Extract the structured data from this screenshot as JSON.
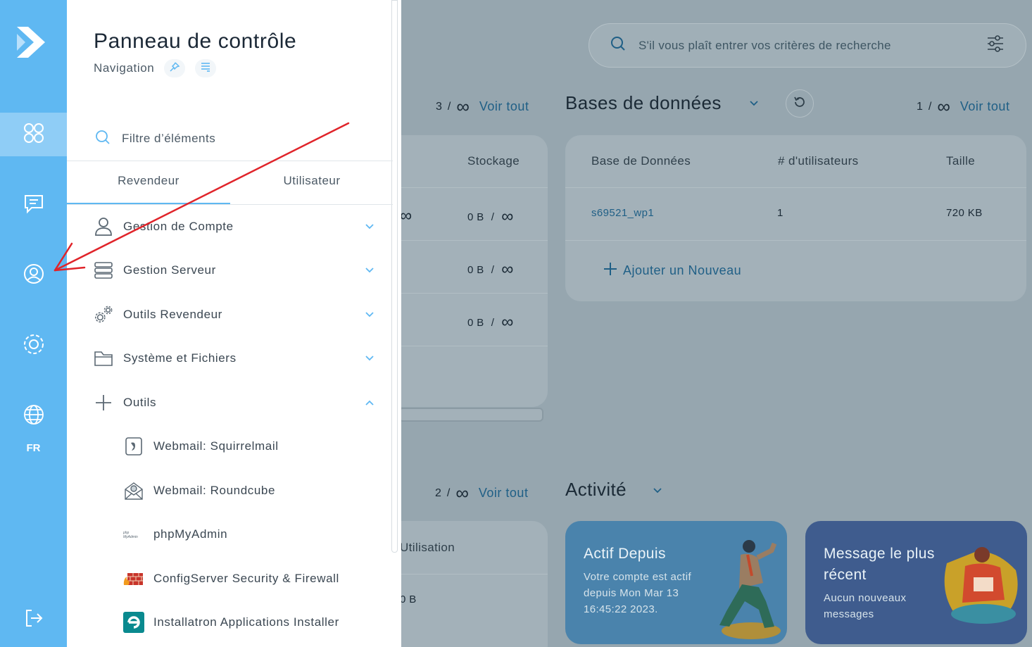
{
  "rail": {
    "items": [
      {
        "icon": "apps-grid-icon",
        "active": true
      },
      {
        "icon": "message-icon",
        "active": false
      },
      {
        "icon": "user-circle-icon",
        "active": false
      },
      {
        "icon": "settings-gear-icon",
        "active": false
      },
      {
        "icon": "globe-icon",
        "active": false
      }
    ],
    "language": "FR",
    "logout_icon": "logout-icon"
  },
  "panel": {
    "title": "Panneau de contrôle",
    "subtitle": "Navigation",
    "filter_placeholder": "Filtre d’éléments",
    "tabs": [
      {
        "label": "Revendeur",
        "active": true
      },
      {
        "label": "Utilisateur",
        "active": false
      }
    ],
    "menu": [
      {
        "label": "Gestion de Compte",
        "icon": "user-icon",
        "expanded": false
      },
      {
        "label": "Gestion Serveur",
        "icon": "server-icon",
        "expanded": false
      },
      {
        "label": "Outils Revendeur",
        "icon": "gears-icon",
        "expanded": false
      },
      {
        "label": "Système et Fichiers",
        "icon": "folder-icon",
        "expanded": false
      },
      {
        "label": "Outils",
        "icon": "plus-icon",
        "expanded": true
      }
    ],
    "submenu": [
      {
        "label": "Webmail: Squirrelmail",
        "icon": "squirrelmail-icon"
      },
      {
        "label": "Webmail: Roundcube",
        "icon": "roundcube-icon"
      },
      {
        "label": "phpMyAdmin",
        "icon": "phpmyadmin-icon"
      },
      {
        "label": "ConfigServer Security & Firewall",
        "icon": "firewall-icon"
      },
      {
        "label": "Installatron Applications Installer",
        "icon": "installatron-icon"
      }
    ]
  },
  "dashboard": {
    "search_placeholder": "S'il vous plaît entrer vos critères de recherche",
    "left_top": {
      "count": "3",
      "separator": "/",
      "infinity": "∞",
      "view_all": "Voir tout",
      "column": "Stockage",
      "rows": [
        {
          "used": "0 B",
          "sep": "/",
          "limit": "∞"
        },
        {
          "used": "0 B",
          "sep": "/",
          "limit": "∞"
        },
        {
          "used": "0 B",
          "sep": "/",
          "limit": "∞"
        }
      ],
      "partial_limit": "∞"
    },
    "databases": {
      "title": "Bases de données",
      "count": "1",
      "separator": "/",
      "infinity": "∞",
      "view_all": "Voir tout",
      "columns": [
        "Base de Données",
        "# d'utilisateurs",
        "Taille"
      ],
      "rows": [
        {
          "name": "s69521_wp1",
          "users": "1",
          "size": "720 KB"
        }
      ],
      "add_label": "Ajouter un Nouveau"
    },
    "left_bottom": {
      "count": "2",
      "separator": "/",
      "infinity": "∞",
      "view_all": "Voir tout",
      "column": "Utilisation",
      "cell": "0 B"
    },
    "activity": {
      "title": "Activité",
      "tiles": [
        {
          "title": "Actif Depuis",
          "text": "Votre compte est actif depuis Mon Mar 13 16:45:22 2023."
        },
        {
          "title": "Message le plus récent",
          "text": "Aucun nouveaux messages"
        }
      ]
    }
  },
  "colors": {
    "rail": "#5fb8f2",
    "accent": "#5fb8f2",
    "overlay_bg": "#96a6af",
    "arrow": "#e0242a"
  }
}
